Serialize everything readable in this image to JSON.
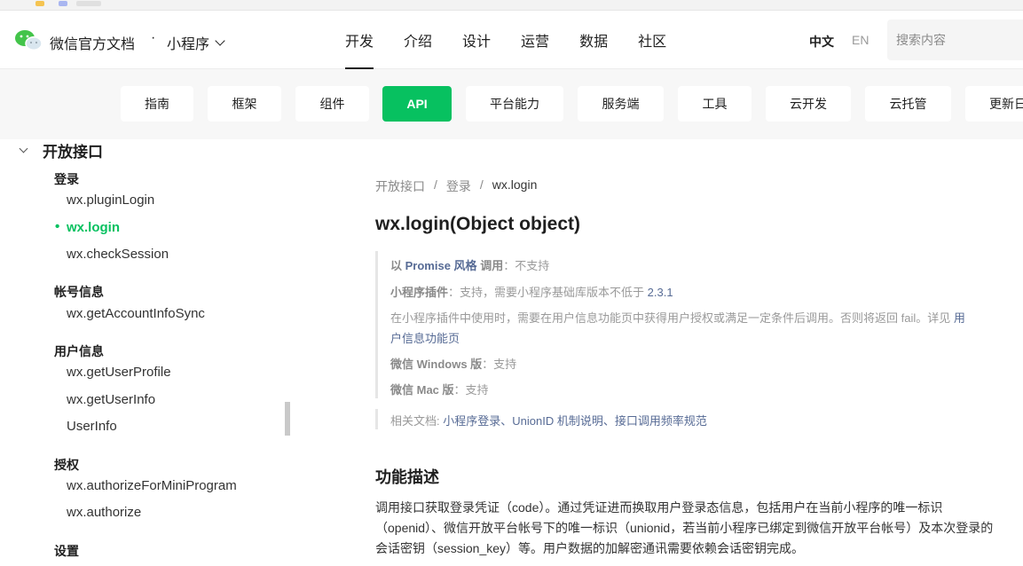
{
  "header": {
    "brand": "微信官方文档",
    "separator": "·",
    "product": "小程序",
    "nav": [
      "开发",
      "介绍",
      "设计",
      "运营",
      "数据",
      "社区"
    ],
    "lang_zh": "中文",
    "lang_en": "EN",
    "search_placeholder": "搜索内容"
  },
  "subnav": {
    "tabs": [
      "指南",
      "框架",
      "组件",
      "API",
      "平台能力",
      "服务端",
      "工具",
      "云开发",
      "云托管",
      "更新日"
    ],
    "active_tab": "API"
  },
  "sidebar": {
    "section": "开放接口",
    "groups": {
      "login": "登录",
      "account": "帐号信息",
      "user": "用户信息",
      "auth": "授权",
      "settings": "设置"
    },
    "items": {
      "pluginLogin": "wx.pluginLogin",
      "login": "wx.login",
      "checkSession": "wx.checkSession",
      "getAccountInfoSync": "wx.getAccountInfoSync",
      "getUserProfile": "wx.getUserProfile",
      "getUserInfo": "wx.getUserInfo",
      "userInfo": "UserInfo",
      "authorizeForMiniProgram": "wx.authorizeForMiniProgram",
      "authorize": "wx.authorize"
    },
    "active_bullet": "•"
  },
  "content": {
    "breadcrumb": [
      "开放接口",
      "登录",
      "wx.login"
    ],
    "breadcrumb_sep": "/",
    "title": "wx.login(Object object)",
    "promise": {
      "prefix": "以",
      "style": "Promise 风格",
      "call": "调用",
      "value": "：不支持"
    },
    "plugin": {
      "label": "小程序插件",
      "value": "：支持，需要小程序基础库版本不低于",
      "version": "2.3.1"
    },
    "plugin_note_1": "在小程序插件中使用时，需要在用户信息功能页中获得用户授权或满足一定条件后调用。否则将返回 fail。详见",
    "plugin_note_link_1": "用",
    "plugin_note_link_2": "户信息功能页",
    "windows": {
      "label": "微信 Windows 版",
      "value": "：支持"
    },
    "mac": {
      "label": "微信 Mac 版",
      "value": "：支持"
    },
    "related_label": "相关文档:",
    "related_links": "小程序登录、UnionID 机制说明、接口调用频率规范",
    "section_title": "功能描述",
    "description_1": "调用接口获取登录凭证（code）。通过凭证进而换取用户登录态信息，包括用户在当前小程序的唯一标识",
    "description_2": "（openid）、微信开放平台帐号下的唯一标识（unionid，若当前小程序已绑定到微信开放平台帐号）及本次登录的",
    "description_3": "会话密钥（session_key）等。用户数据的加解密通讯需要依赖会话密钥完成。"
  },
  "colors": {
    "accent": "#07c160",
    "link": "#576b95",
    "subnav_bg": "#f7f7f7"
  }
}
